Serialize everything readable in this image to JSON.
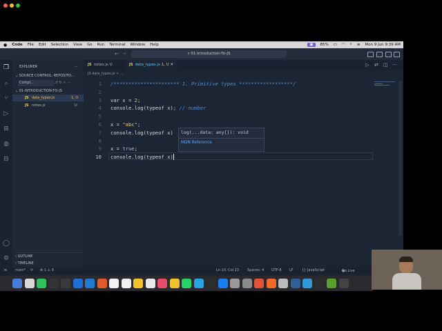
{
  "menubar": {
    "items": [
      "Code",
      "File",
      "Edit",
      "Selection",
      "View",
      "Go",
      "Run",
      "Terminal",
      "Window",
      "Help"
    ],
    "battery": "85%",
    "datetime": "Mon 9 Jun  9:39 AM"
  },
  "titlebar": {
    "command_center": "01-Introduction-To-JS"
  },
  "sidebar": {
    "explorer": "EXPLORER",
    "source_control": "SOURCE CONTROL: REPOSITO...",
    "commit": "Compl...",
    "folder": "01-INTRODUCTION-TO-JS",
    "files": [
      {
        "name": "data_types.js",
        "badge": "1, U"
      },
      {
        "name": "notes.js",
        "badge": "U"
      }
    ],
    "outline": "OUTLINE",
    "timeline": "TIMELINE"
  },
  "tabs": [
    {
      "icon": "JS",
      "label": "notes.js",
      "badge": "U"
    },
    {
      "icon": "JS",
      "label": "data_types.js",
      "badge": "1, U"
    }
  ],
  "breadcrumb": "JS data_types.js > ...",
  "editor": {
    "line_numbers": [
      "1",
      "2",
      "3",
      "4",
      "5",
      "6",
      "7",
      "8",
      "9",
      "10"
    ],
    "lines": [
      {
        "ln": "1",
        "segments": [
          {
            "t": "/********************** 1. Primitive types ******************/",
            "c": "cmt"
          }
        ]
      },
      {
        "ln": "2",
        "segments": []
      },
      {
        "ln": "3",
        "segments": [
          {
            "t": "var",
            "c": ""
          },
          {
            "t": " x = ",
            "c": ""
          },
          {
            "t": "2",
            "c": "num"
          },
          {
            "t": ";",
            "c": ""
          }
        ]
      },
      {
        "ln": "4",
        "segments": [
          {
            "t": "console.log(typeof x); ",
            "c": ""
          },
          {
            "t": "// number",
            "c": "cmt"
          }
        ]
      },
      {
        "ln": "5",
        "segments": []
      },
      {
        "ln": "6",
        "segments": [
          {
            "t": "x = ",
            "c": ""
          },
          {
            "t": "\"abc\"",
            "c": "str"
          },
          {
            "t": ";",
            "c": ""
          }
        ]
      },
      {
        "ln": "7",
        "segments": [
          {
            "t": "console.log(typeof x)",
            "c": ""
          }
        ]
      },
      {
        "ln": "8",
        "segments": []
      },
      {
        "ln": "9",
        "segments": [
          {
            "t": "x = ",
            "c": ""
          },
          {
            "t": "true",
            "c": "kw"
          },
          {
            "t": ";",
            "c": ""
          }
        ]
      },
      {
        "ln": "10",
        "segments": [
          {
            "t": "console.log(typeof x)",
            "c": ""
          }
        ]
      }
    ]
  },
  "hover": {
    "signature": "log(...data: any[]): void",
    "link": "MDN Reference"
  },
  "statusbar": {
    "branch": "main*",
    "problems": "⊗ 1 ⚠ 0",
    "position": "Ln 10, Col 23",
    "spaces": "Spaces: 4",
    "encoding": "UTF-8",
    "eol": "LF",
    "language": "{} JavaScript",
    "golive": "Go Live"
  },
  "dock_colors": [
    "#4a7bd8",
    "#d8d8d8",
    "#2fc25b",
    "#333",
    "#3a3a3a",
    "#1f6fd6",
    "#1e7bd1",
    "#e25a2b",
    "#f2f2f2",
    "#f0f0f0",
    "#f4c430",
    "#e8e8e8",
    "#e84b6a",
    "#f0c230",
    "#25d366",
    "#2aa3e0",
    "#2d2d2d",
    "#1a7ef0",
    "#999",
    "#8a8a8a",
    "#e0523a",
    "#f06a2a",
    "#bcbcbc",
    "#2f5f9a",
    "#2f9ad6",
    "#2d2d2d",
    "#5aa02c",
    "#444"
  ]
}
